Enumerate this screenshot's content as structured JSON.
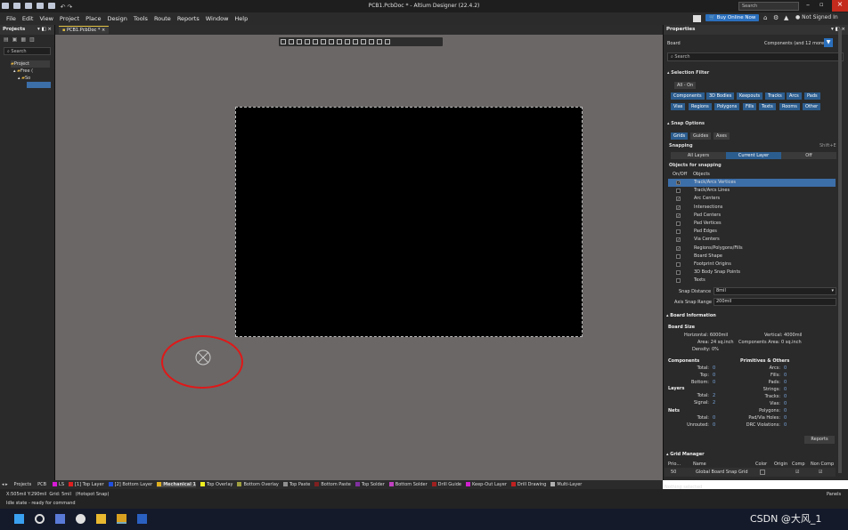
{
  "window": {
    "title": "PCB1.PcbDoc * - Altium Designer (22.4.2)",
    "search": "Search",
    "buy_online": "Buy Online Now",
    "not_signed_in": "Not Signed In"
  },
  "menu": [
    "File",
    "Edit",
    "View",
    "Project",
    "Place",
    "Design",
    "Tools",
    "Route",
    "Reports",
    "Window",
    "Help"
  ],
  "projects_panel": {
    "title": "Projects",
    "search": "Search",
    "tree": [
      "Project",
      "Free (",
      "So",
      ""
    ]
  },
  "doc_tab": "PCB1.PcbDoc *",
  "properties": {
    "title": "Properties",
    "board_label": "Board",
    "filter_label": "Components (and 12 more)",
    "search": "Search",
    "selection_filter": {
      "title": "Selection Filter",
      "all_on": "All - On",
      "chips": [
        "Components",
        "3D Bodies",
        "Keepouts",
        "Tracks",
        "Arcs",
        "Pads",
        "Vias",
        "Regions",
        "Polygons",
        "Fills",
        "Texts",
        "Rooms",
        "Other"
      ]
    },
    "snap_options": {
      "title": "Snap Options",
      "tabs": [
        "Grids",
        "Guides",
        "Axes"
      ],
      "snapping_label": "Snapping",
      "shortcut": "Shift+E",
      "modes": [
        "All Layers",
        "Current Layer",
        "Off"
      ],
      "objects_title": "Objects for snapping",
      "col_onoff": "On/Off",
      "col_objects": "Objects",
      "objects": [
        {
          "name": "Track/Arcs Vertices",
          "on": true
        },
        {
          "name": "Track/Arcs Lines",
          "on": false
        },
        {
          "name": "Arc Centers",
          "on": true
        },
        {
          "name": "Intersections",
          "on": true
        },
        {
          "name": "Pad Centers",
          "on": true
        },
        {
          "name": "Pad Vertices",
          "on": false
        },
        {
          "name": "Pad Edges",
          "on": false
        },
        {
          "name": "Via Centers",
          "on": true
        },
        {
          "name": "Regions/Polygons/Fills",
          "on": true
        },
        {
          "name": "Board Shape",
          "on": false
        },
        {
          "name": "Footprint Origins",
          "on": false
        },
        {
          "name": "3D Body Snap Points",
          "on": false
        },
        {
          "name": "Texts",
          "on": false
        }
      ],
      "snap_distance_label": "Snap Distance",
      "snap_distance": "8mil",
      "axis_range_label": "Axis Snap Range",
      "axis_range": "200mil"
    },
    "board_info": {
      "title": "Board Information",
      "size_title": "Board Size",
      "horizontal_label": "Horizontal:",
      "horizontal": "6000mil",
      "vertical_label": "Vertical:",
      "vertical": "4000mil",
      "area_label": "Area:",
      "area": "24 sq.inch",
      "comp_area_label": "Components Area:",
      "comp_area": "0 sq.inch",
      "density_label": "Density:",
      "density": "0%",
      "components_title": "Components",
      "comp_rows": [
        {
          "label": "Total:",
          "value": "0"
        },
        {
          "label": "Top:",
          "value": "0"
        },
        {
          "label": "Bottom:",
          "value": "0"
        }
      ],
      "layers_title": "Layers",
      "layer_rows": [
        {
          "label": "Total:",
          "value": "2"
        },
        {
          "label": "Signal:",
          "value": "2"
        }
      ],
      "nets_title": "Nets",
      "net_rows": [
        {
          "label": "Total:",
          "value": "0"
        },
        {
          "label": "Unrouted:",
          "value": "0"
        }
      ],
      "primitives_title": "Primitives & Others",
      "prim_rows": [
        {
          "label": "Arcs:",
          "value": "0"
        },
        {
          "label": "Fills:",
          "value": "0"
        },
        {
          "label": "Pads:",
          "value": "0"
        },
        {
          "label": "Strings:",
          "value": "0"
        },
        {
          "label": "Tracks:",
          "value": "0"
        },
        {
          "label": "Vias:",
          "value": "0"
        },
        {
          "label": "Polygons:",
          "value": "0"
        },
        {
          "label": "Pad/Via Holes:",
          "value": "0"
        },
        {
          "label": "DRC Violations:",
          "value": "0"
        }
      ],
      "reports_btn": "Reports"
    },
    "grid_manager": {
      "title": "Grid Manager",
      "cols": [
        "Prio...",
        "Name",
        "Color",
        "Origin",
        "Comp",
        "Non Comp"
      ],
      "row": {
        "prio": "50",
        "name": "Global Board Snap Grid"
      }
    },
    "nothing_selected": "Nothing selected",
    "panels_btn": "Panels"
  },
  "layer_tabs": [
    {
      "label": "LS",
      "color": "#d81ad8"
    },
    {
      "label": "[1] Top Layer",
      "color": "#e02020"
    },
    {
      "label": "[2] Bottom Layer",
      "color": "#2050e0"
    },
    {
      "label": "Mechanical 1",
      "color": "#e0b020"
    },
    {
      "label": "Top Overlay",
      "color": "#f0f020"
    },
    {
      "label": "Bottom Overlay",
      "color": "#a0a040"
    },
    {
      "label": "Top Paste",
      "color": "#909090"
    },
    {
      "label": "Bottom Paste",
      "color": "#802020"
    },
    {
      "label": "Top Solder",
      "color": "#8030a0"
    },
    {
      "label": "Bottom Solder",
      "color": "#c040c0"
    },
    {
      "label": "Drill Guide",
      "color": "#a02020"
    },
    {
      "label": "Keep-Out Layer",
      "color": "#d020d0"
    },
    {
      "label": "Drill Drawing",
      "color": "#c02020"
    },
    {
      "label": "Multi-Layer",
      "color": "#b0b0b0"
    }
  ],
  "layer_prefix": [
    "Projects",
    "PCB"
  ],
  "status": {
    "coords": "X:505mil Y:290mil",
    "grid": "Grid: 5mil",
    "hotspot": "(Hotspot Snap)",
    "idle": "Idle state - ready for command"
  },
  "watermark": "CSDN @大风_1",
  "colors": {
    "accent": "#2a6fbd",
    "board": "#000000",
    "canvas": "#6b6766",
    "annotation": "#e01818"
  }
}
